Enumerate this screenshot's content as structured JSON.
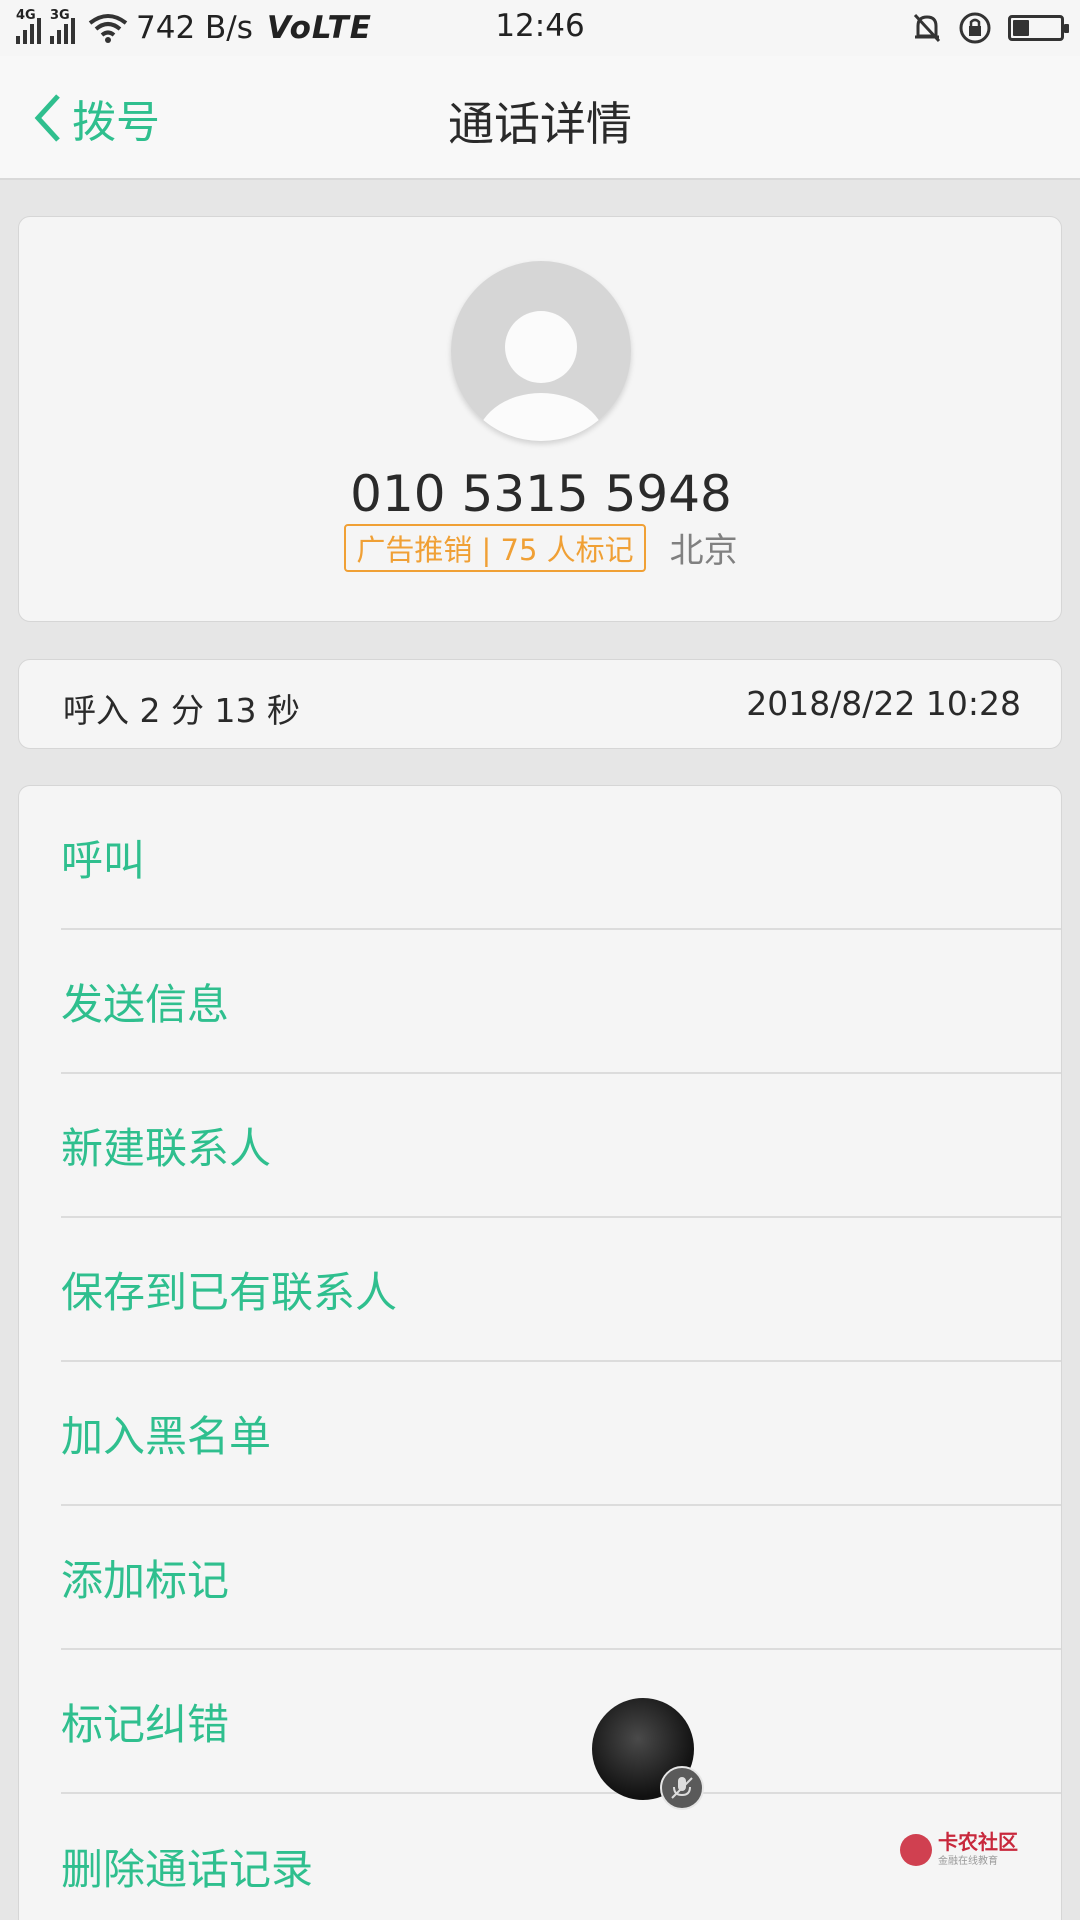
{
  "status_bar": {
    "signal1_label": "4G",
    "signal2_label": "3G",
    "net_speed": "742 B/s",
    "volte": "VoLTE",
    "time": "12:46",
    "battery_level": 0.35
  },
  "nav": {
    "back_label": "拨号",
    "title": "通话详情"
  },
  "contact": {
    "phone": "010 5315 5948",
    "spam_tag": "广告推销 | 75 人标记",
    "location": "北京"
  },
  "call_log": {
    "summary": "呼入  2 分 13 秒",
    "datetime": "2018/8/22 10:28"
  },
  "actions": [
    {
      "label": "呼叫"
    },
    {
      "label": "发送信息"
    },
    {
      "label": "新建联系人"
    },
    {
      "label": "保存到已有联系人"
    },
    {
      "label": "加入黑名单"
    },
    {
      "label": "添加标记"
    },
    {
      "label": "标记纠错"
    },
    {
      "label": "删除通话记录"
    }
  ],
  "watermark": {
    "title": "卡农社区",
    "subtitle": "金融在线教育"
  },
  "colors": {
    "accent": "#2fbf8e",
    "spam": "#f0a035"
  }
}
